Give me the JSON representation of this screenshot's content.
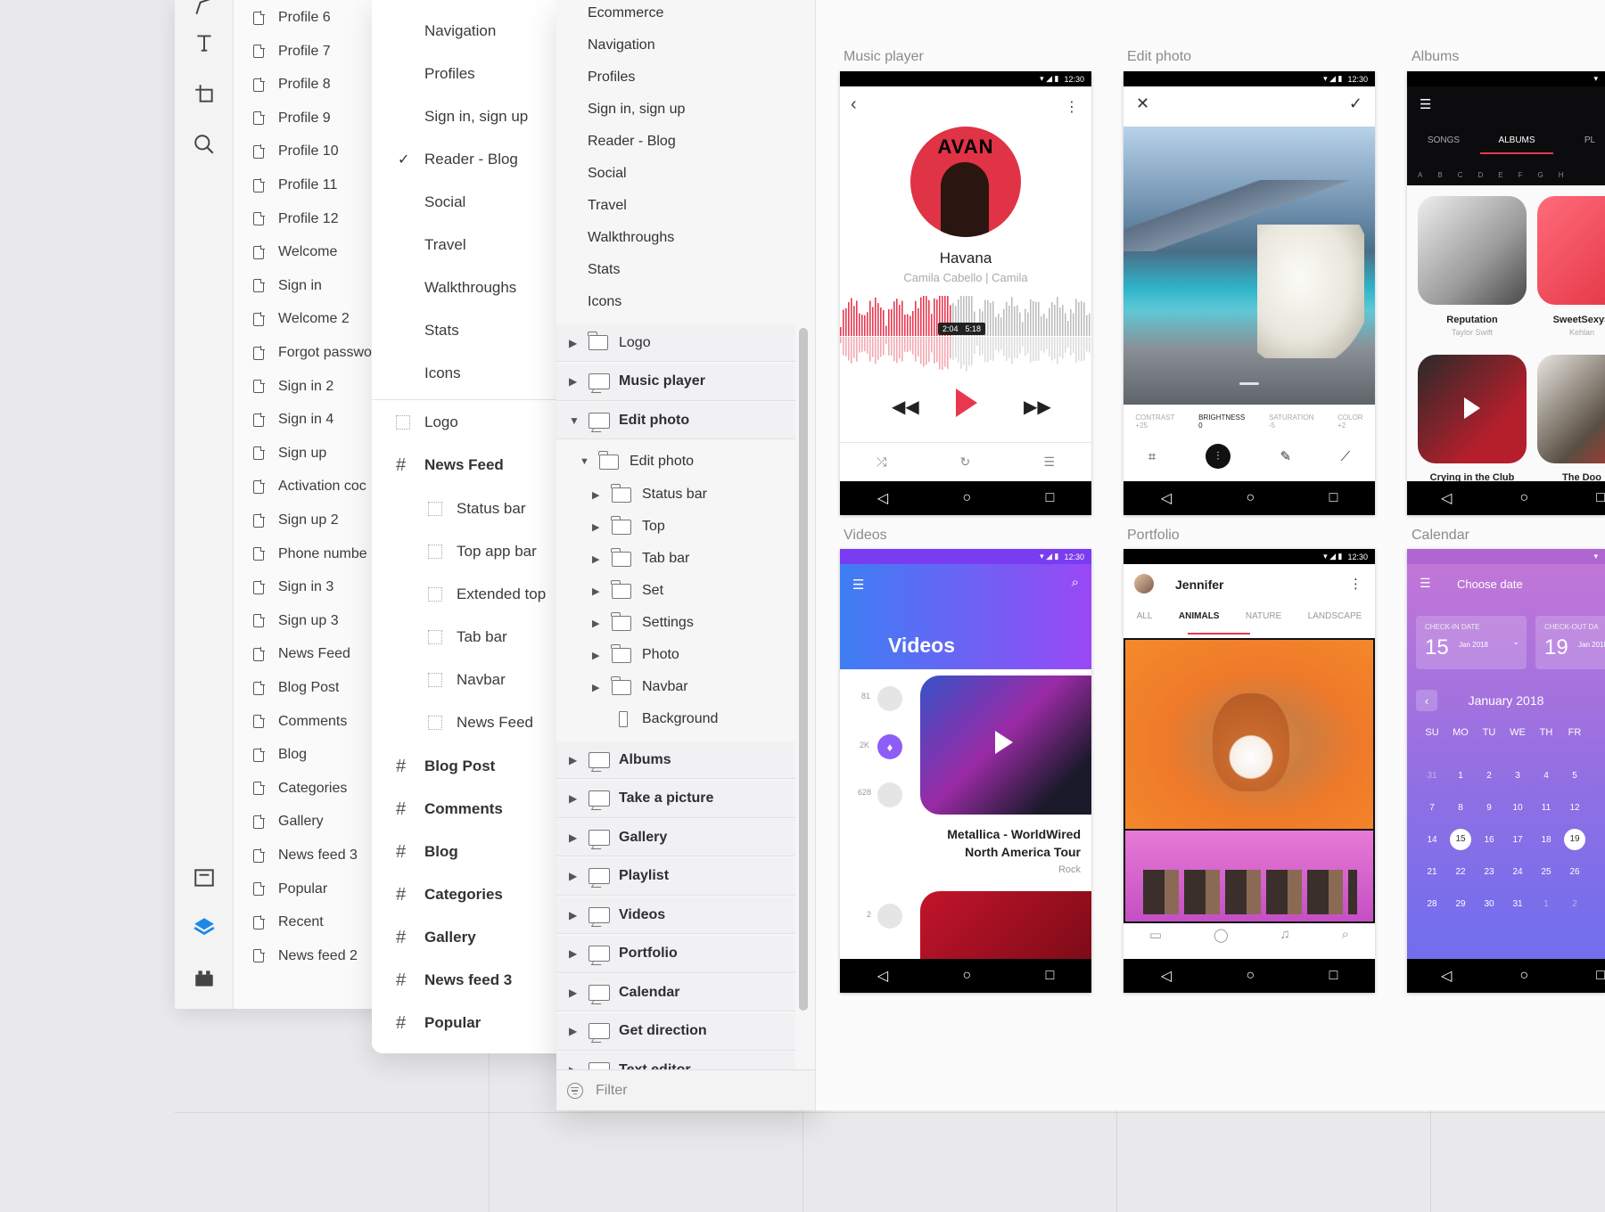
{
  "page_list": [
    "Profile 6",
    "Profile 7",
    "Profile 8",
    "Profile 9",
    "Profile 10",
    "Profile 11",
    "Profile 12",
    "Welcome",
    "Sign in",
    "Welcome 2",
    "Forgot passwo",
    "Sign in 2",
    "Sign in 4",
    "Sign up",
    "Activation coc",
    "Sign up 2",
    "Phone numbe",
    "Sign in 3",
    "Sign up 3",
    "News Feed",
    "Blog Post",
    "Comments",
    "Blog",
    "Categories",
    "Gallery",
    "News feed 3",
    "Popular",
    "Recent",
    "News feed 2"
  ],
  "categories": {
    "plain": [
      "Navigation",
      "Profiles",
      "Sign in, sign up",
      "Reader - Blog",
      "Social",
      "Travel",
      "Walkthroughs",
      "Stats",
      "Icons"
    ],
    "checked": "Reader - Blog",
    "logo": "Logo",
    "news_feed": "News Feed",
    "news_feed_children": [
      "Status bar",
      "Top app bar",
      "Extended top",
      "Tab bar",
      "Navbar",
      "News Feed"
    ],
    "artboards": [
      "Blog Post",
      "Comments",
      "Blog",
      "Categories",
      "Gallery",
      "News feed 3",
      "Popular"
    ]
  },
  "layers": {
    "top_items": [
      "Ecommerce",
      "Navigation",
      "Profiles",
      "Sign in, sign up",
      "Reader - Blog",
      "Social",
      "Travel",
      "Walkthroughs",
      "Stats",
      "Icons"
    ],
    "groups_before": [
      "Logo",
      "Music player",
      "Edit photo"
    ],
    "edit_photo_folder": "Edit photo",
    "edit_photo_children": [
      "Status bar",
      "Top",
      "Tab bar",
      "Set",
      "Settings",
      "Photo",
      "Navbar",
      "Background"
    ],
    "groups_after": [
      "Albums",
      "Take a picture",
      "Gallery",
      "Playlist",
      "Videos",
      "Portfolio",
      "Calendar",
      "Get direction",
      "Text editor"
    ],
    "filter_placeholder": "Filter"
  },
  "canvas": {
    "labels": [
      "Music player",
      "Edit photo",
      "Albums",
      "Videos",
      "Portfolio",
      "Calendar"
    ],
    "status_time": "12:30",
    "music": {
      "title": "Havana",
      "artist": "Camila Cabello | Camila",
      "elapsed": "2:04",
      "total": "5:18",
      "cover_text": "AVAN"
    },
    "edit": {
      "tools": [
        "CONTRAST",
        "BRIGHTNESS",
        "SATURATION",
        "COLOR"
      ],
      "values": [
        "+25",
        "0",
        "-5",
        "+2"
      ]
    },
    "albums": {
      "tabs": [
        "SONGS",
        "ALBUMS",
        "PL"
      ],
      "letters": [
        "A",
        "B",
        "C",
        "D",
        "E",
        "F",
        "G",
        "H"
      ],
      "items": [
        {
          "title": "Reputation",
          "artist": "Taylor Swift"
        },
        {
          "title": "SweetSexyS",
          "artist": "Kehlan"
        },
        {
          "title": "Crying in the Club",
          "artist": ""
        },
        {
          "title": "The Doo",
          "artist": ""
        }
      ]
    },
    "videos": {
      "title": "Videos",
      "counts": [
        "81",
        "2K",
        "628",
        "2"
      ],
      "video_title_1": "Metallica - WorldWired",
      "video_title_2": "North America Tour",
      "genre": "Rock"
    },
    "portfolio": {
      "user": "Jennifer",
      "tabs": [
        "ALL",
        "ANIMALS",
        "NATURE",
        "LANDSCAPE"
      ]
    },
    "calendar": {
      "title": "Choose date",
      "checkin": "CHECK-IN DATE",
      "checkout": "CHECK-OUT DA",
      "day_in": "15",
      "day_out": "19",
      "month_small": "Jan 2018",
      "month": "January 2018",
      "weekdays": [
        "SU",
        "MO",
        "TU",
        "WE",
        "TH",
        "FR"
      ],
      "weeks": [
        [
          "31",
          "1",
          "2",
          "3",
          "4",
          "5"
        ],
        [
          "7",
          "8",
          "9",
          "10",
          "11",
          "12"
        ],
        [
          "14",
          "15",
          "16",
          "17",
          "18",
          "19"
        ],
        [
          "21",
          "22",
          "23",
          "24",
          "25",
          "26"
        ],
        [
          "28",
          "29",
          "30",
          "31",
          "1",
          "2"
        ]
      ]
    }
  },
  "colors": {
    "accent": "#e8384f",
    "blue": "#2196f3",
    "violet": "#8e5cf7"
  }
}
